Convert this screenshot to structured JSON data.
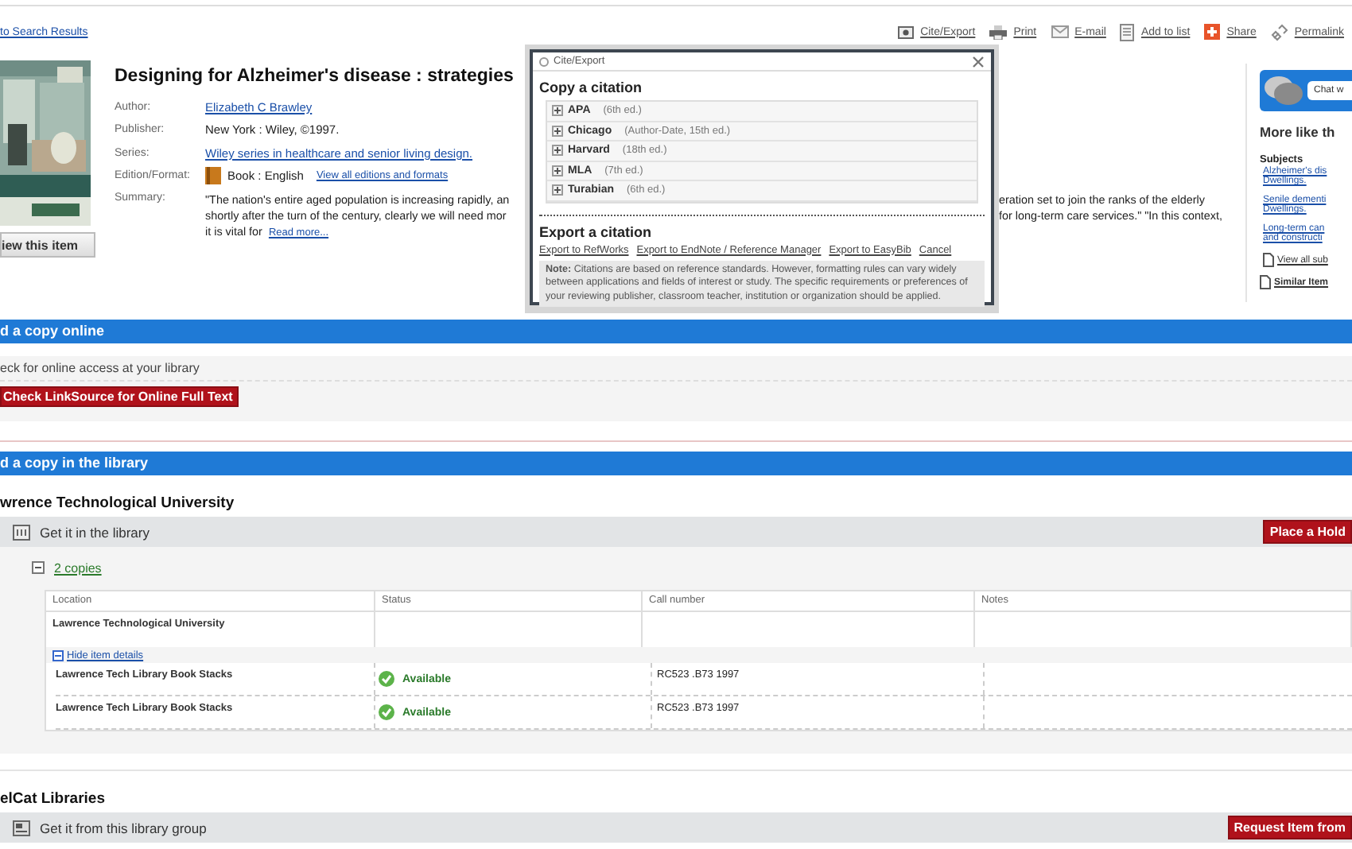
{
  "back_link": "to Search Results",
  "toolbar": [
    {
      "kind": "cite",
      "label": "Cite/Export"
    },
    {
      "kind": "print",
      "label": "Print"
    },
    {
      "kind": "email",
      "label": "E-mail"
    },
    {
      "kind": "list",
      "label": "Add to list"
    },
    {
      "kind": "share",
      "label": "Share"
    },
    {
      "kind": "permalink",
      "label": "Permalink"
    }
  ],
  "item": {
    "title": "Designing for Alzheimer's disease : strategies",
    "fields": [
      {
        "kind": "link",
        "label": "Author:",
        "value": "Elizabeth C Brawley"
      },
      {
        "kind": "text",
        "label": "Publisher:",
        "value": "New York : Wiley, ©1997."
      },
      {
        "kind": "link",
        "label": "Series:",
        "value": "Wiley series in healthcare and senior living design."
      },
      {
        "kind": "format",
        "label": "Edition/Format:",
        "value": "Book : English",
        "link": "View all editions and formats"
      }
    ],
    "summary": {
      "label": "Summary:",
      "lines": [
        {
          "left": "\"The nation's entire aged population is increasing rapidly, an",
          "right": "eration set to join the ranks of the elderly"
        },
        {
          "left": "shortly after the turn of the century, clearly we will need mor",
          "right": "for long-term care services.\" \"In this context,"
        },
        {
          "left": "it is vital for",
          "link": "Read more..."
        }
      ]
    },
    "view_button": "iew this item"
  },
  "citation_dialog": {
    "title": "Cite/Export",
    "copy_heading": "Copy a citation",
    "styles": [
      {
        "name": "APA",
        "edition": "(6th ed.)"
      },
      {
        "name": "Chicago",
        "edition": "(Author-Date, 15th ed.)"
      },
      {
        "name": "Harvard",
        "edition": "(18th ed.)"
      },
      {
        "name": "MLA",
        "edition": "(7th ed.)"
      },
      {
        "name": "Turabian",
        "edition": "(6th ed.)"
      }
    ],
    "export_heading": "Export a citation",
    "export_links": [
      "Export to RefWorks",
      "Export to EndNote / Reference Manager",
      "Export to EasyBib",
      "Cancel"
    ],
    "note": "**Note:** Citations are based on reference standards. However, formatting rules can vary widely between applications and fields of interest or study. The specific requirements or preferences of your reviewing publisher, classroom teacher, institution or organization should be applied."
  },
  "sidebar": {
    "chat": "Chat w",
    "heading": "More like th",
    "subjects_label": "Subjects",
    "subjects": [
      {
        "lines": [
          "Alzheimer's dis",
          "Dwellings."
        ]
      },
      {
        "lines": [
          "Senile dementi",
          "Dwellings."
        ]
      },
      {
        "lines": [
          "Long-term can",
          "and constructi"
        ]
      }
    ],
    "view_all": "View all sub",
    "similar": "Similar Item"
  },
  "online": {
    "heading": "d a copy online",
    "prompt": "eck for online access at your library",
    "button": "Check LinkSource for Online Full Text"
  },
  "library": {
    "heading": "d a copy in the library",
    "institution": "wrence Technological University",
    "get_it": "Get it in the library",
    "hold_button": "Place a Hold",
    "copies": {
      "label": "2 copies",
      "expanded": true
    },
    "columns": [
      "Location",
      "Status",
      "Call number",
      "Notes"
    ],
    "location": "Lawrence Technological University",
    "details_toggle": {
      "label": "Hide item details",
      "expanded": true
    },
    "items": [
      {
        "location": "Lawrence Tech Library Book Stacks",
        "status": "Available",
        "call_number": "RC523 .B73 1997"
      },
      {
        "location": "Lawrence Tech Library Book Stacks",
        "status": "Available",
        "call_number": "RC523 .B73 1997"
      }
    ]
  },
  "group": {
    "name": "elCat Libraries",
    "get_it": "Get it from this library group",
    "button": "Request Item from"
  }
}
